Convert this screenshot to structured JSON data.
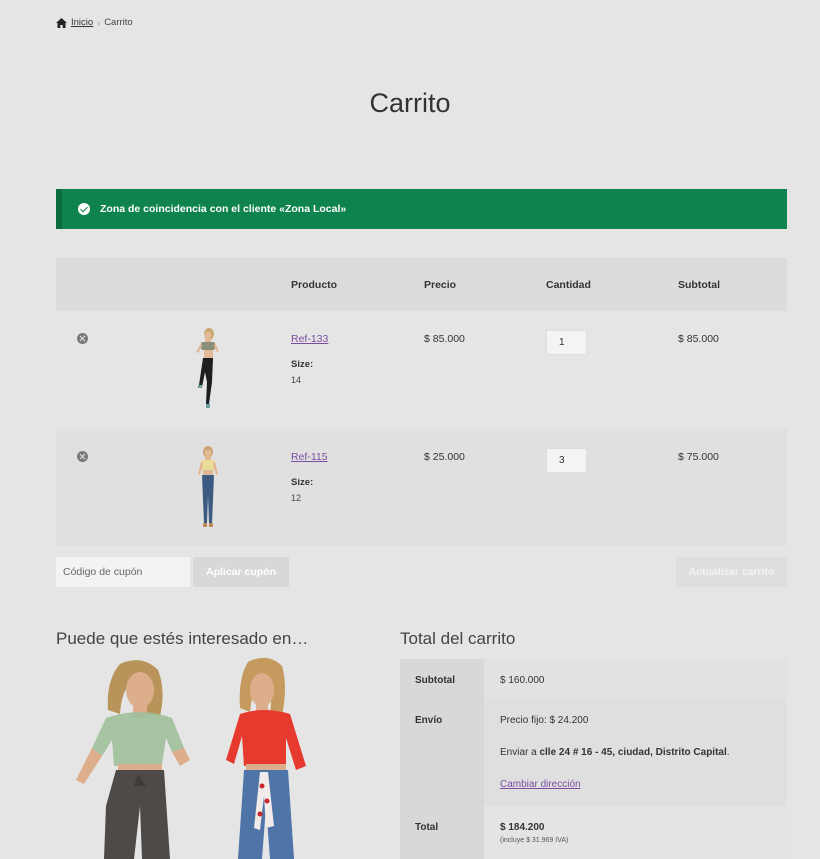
{
  "breadcrumb": {
    "home": "Inicio",
    "current": "Carrito",
    "separator": "›"
  },
  "page": {
    "title": "Carrito"
  },
  "notice": {
    "text": "Zona de coincidencia con el cliente «Zona Local»",
    "color": "#0f834d"
  },
  "cart": {
    "headers": {
      "product": "Producto",
      "price": "Precio",
      "quantity": "Cantidad",
      "subtotal": "Subtotal"
    },
    "items": [
      {
        "name": "Ref-133",
        "size_label": "Size:",
        "size": "14",
        "price": "$ 85.000",
        "quantity": "1",
        "subtotal": "$ 85.000"
      },
      {
        "name": "Ref-115",
        "size_label": "Size:",
        "size": "12",
        "price": "$ 25.000",
        "quantity": "3",
        "subtotal": "$ 75.000"
      }
    ]
  },
  "coupon": {
    "placeholder": "Código de cupón",
    "apply_label": "Aplicar cupón"
  },
  "update_label": "Actualizar carrito",
  "cross_sells": {
    "title": "Puede que estés interesado en…"
  },
  "totals": {
    "title": "Total del carrito",
    "subtotal_label": "Subtotal",
    "subtotal_value": "$ 160.000",
    "shipping_label": "Envío",
    "shipping_rate": "Precio fijo: $ 24.200",
    "shipping_to_prefix": "Enviar a",
    "shipping_address": "clle 24 # 16 - 45, ciudad, Distrito Capital",
    "change_address": "Cambiar dirección",
    "total_label": "Total",
    "total_value": "$ 184.200",
    "tax_note": "(incluye $ 31.969 IVA)"
  },
  "link_color": "#7a4fa0"
}
